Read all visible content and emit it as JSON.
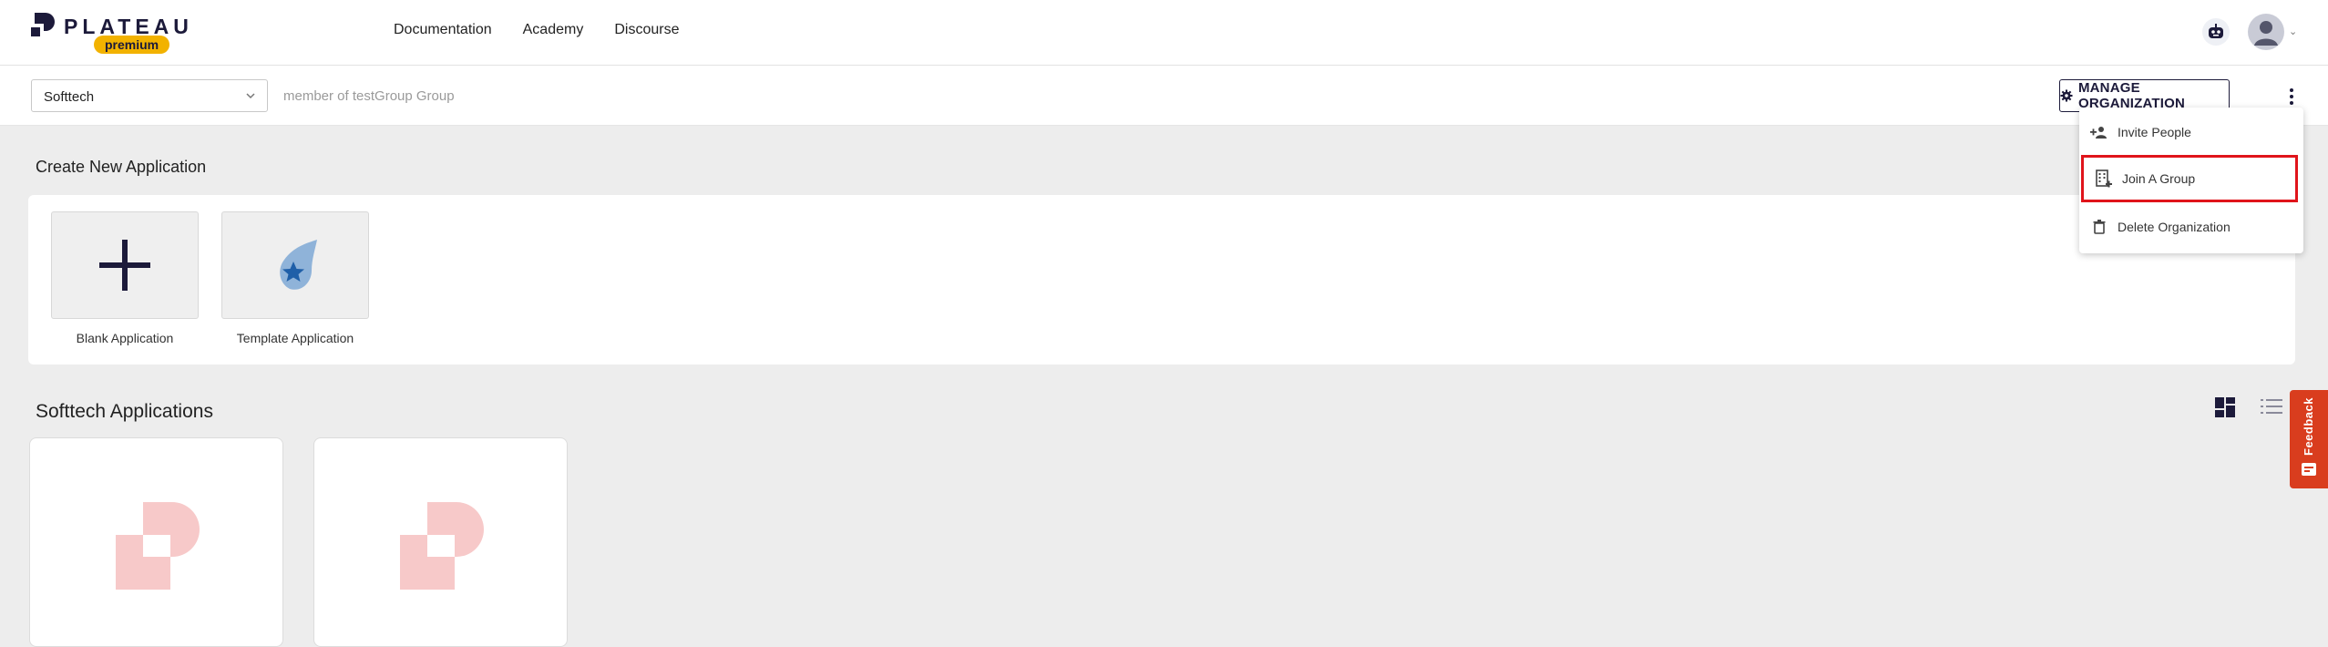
{
  "header": {
    "logo_text": "PLATEAU",
    "logo_badge": "premium",
    "nav": [
      {
        "label": "Documentation"
      },
      {
        "label": "Academy"
      },
      {
        "label": "Discourse"
      }
    ]
  },
  "subbar": {
    "org_select_value": "Softtech",
    "member_text": "member of testGroup Group",
    "manage_label": "MANAGE ORGANIZATION"
  },
  "create": {
    "title": "Create New Application",
    "tiles": [
      {
        "label": "Blank Application",
        "icon": "plus-icon"
      },
      {
        "label": "Template Application",
        "icon": "star-flame-icon"
      }
    ]
  },
  "apps": {
    "title": "Softtech Applications"
  },
  "menu": {
    "items": [
      {
        "label": "Invite People",
        "icon": "add-people-icon"
      },
      {
        "label": "Join A Group",
        "icon": "building-add-icon"
      },
      {
        "label": "Delete Organization",
        "icon": "trash-icon"
      }
    ]
  },
  "feedback": {
    "label": "Feedback"
  },
  "colors": {
    "brand_dark": "#1c1a3a",
    "badge": "#f2b200",
    "highlight": "#e0141b",
    "feedback": "#d93d1e",
    "app_logo": "#f7c9c9"
  }
}
